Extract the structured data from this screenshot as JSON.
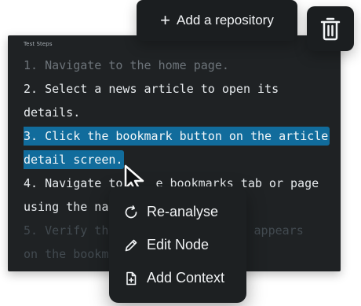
{
  "toolbar": {
    "add_repository_label": "Add a repository",
    "add_repository_icon": "plus-icon",
    "delete_icon": "trash-icon"
  },
  "panel": {
    "title": "Test Steps",
    "steps": [
      "1. Navigate to the home page.",
      "2. Select a news article to open its",
      "details.",
      "3. Click the bookmark button on the article",
      "detail screen.",
      "4. Navigate to the bookmarks tab or page",
      "using the na",
      "5. Verify th",
      "on the bookm"
    ],
    "step4_tail": "e bookmarks tab or page",
    "step4_head": "4. Navigate to",
    "step5_tail": "icle appears"
  },
  "context_menu": {
    "items": [
      {
        "label": "Re-analyse",
        "icon": "refresh-icon"
      },
      {
        "label": "Edit Node",
        "icon": "pencil-icon"
      },
      {
        "label": "Add Context",
        "icon": "add-file-icon"
      }
    ]
  },
  "colors": {
    "panel_bg": "#1f2224",
    "highlight": "#116c9c",
    "menu_bg": "#1d2022",
    "button_bg": "#1b1e20"
  }
}
